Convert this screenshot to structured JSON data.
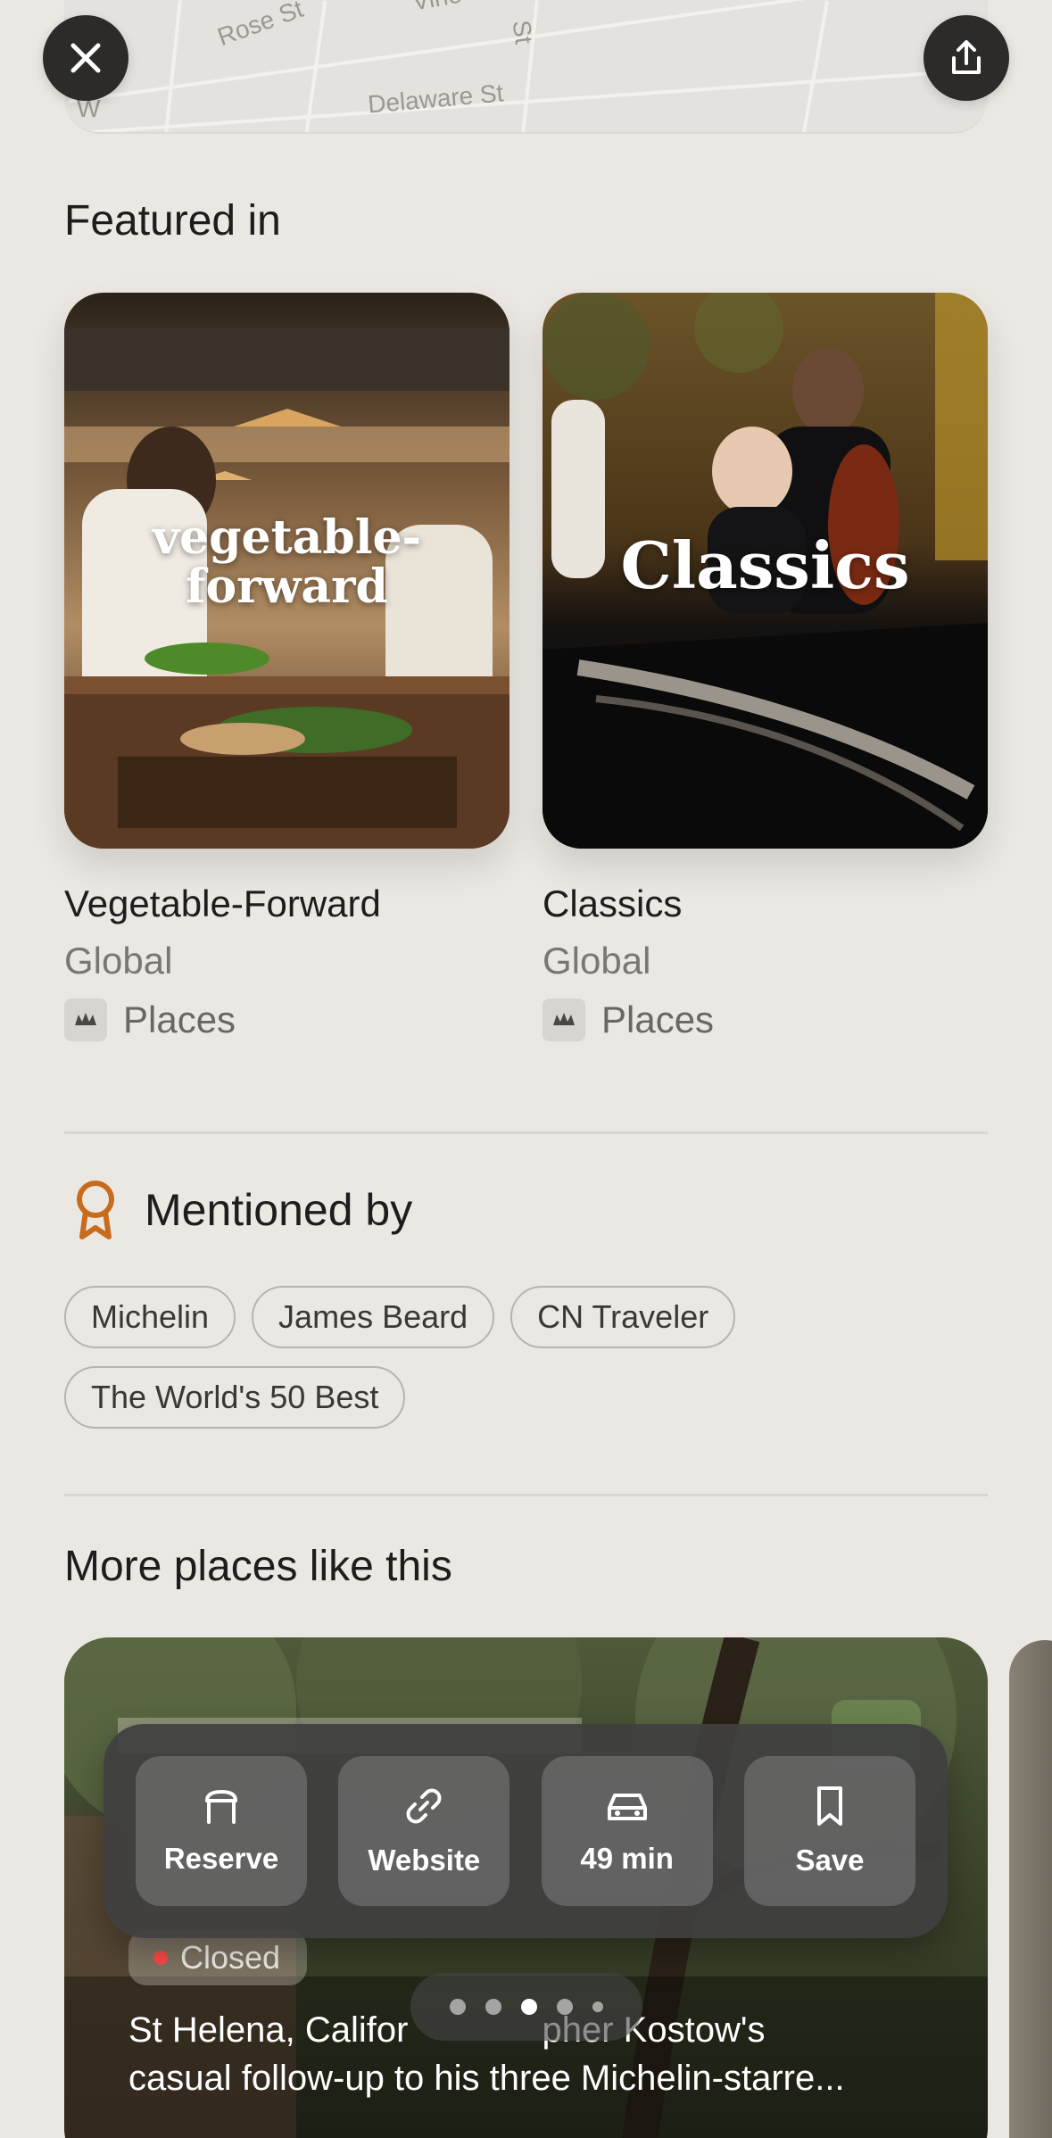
{
  "map": {
    "streets": [
      "Rose St",
      "Vine",
      "Delaware St",
      "St",
      "W"
    ]
  },
  "header": {
    "close_icon": "close-icon",
    "share_icon": "share-icon"
  },
  "featured": {
    "title": "Featured in",
    "cards": [
      {
        "image_text": "vegetable-\nforward",
        "name": "Vegetable-Forward",
        "scope": "Global",
        "meta": "Places"
      },
      {
        "image_text": "Classics",
        "name": "Classics",
        "scope": "Global",
        "meta": "Places"
      }
    ]
  },
  "mentioned": {
    "title": "Mentioned by",
    "icon": "award-ribbon-icon",
    "accent": "#c76b1d",
    "chips": [
      "Michelin",
      "James Beard",
      "CN Traveler",
      "The World's 50 Best"
    ]
  },
  "more": {
    "title": "More places like this",
    "card": {
      "status": "Closed",
      "status_color": "#ff4a4a",
      "description_line1": "St Helena, Califor",
      "description_line1_tail": "pher Kostow's",
      "description_line2": "casual follow-up to his three Michelin-starre..."
    },
    "pager": {
      "count": 5,
      "active": 2
    }
  },
  "actions": [
    {
      "icon": "chair-icon",
      "label": "Reserve"
    },
    {
      "icon": "link-icon",
      "label": "Website"
    },
    {
      "icon": "car-icon",
      "label": "49 min"
    },
    {
      "icon": "bookmark-icon",
      "label": "Save"
    }
  ]
}
